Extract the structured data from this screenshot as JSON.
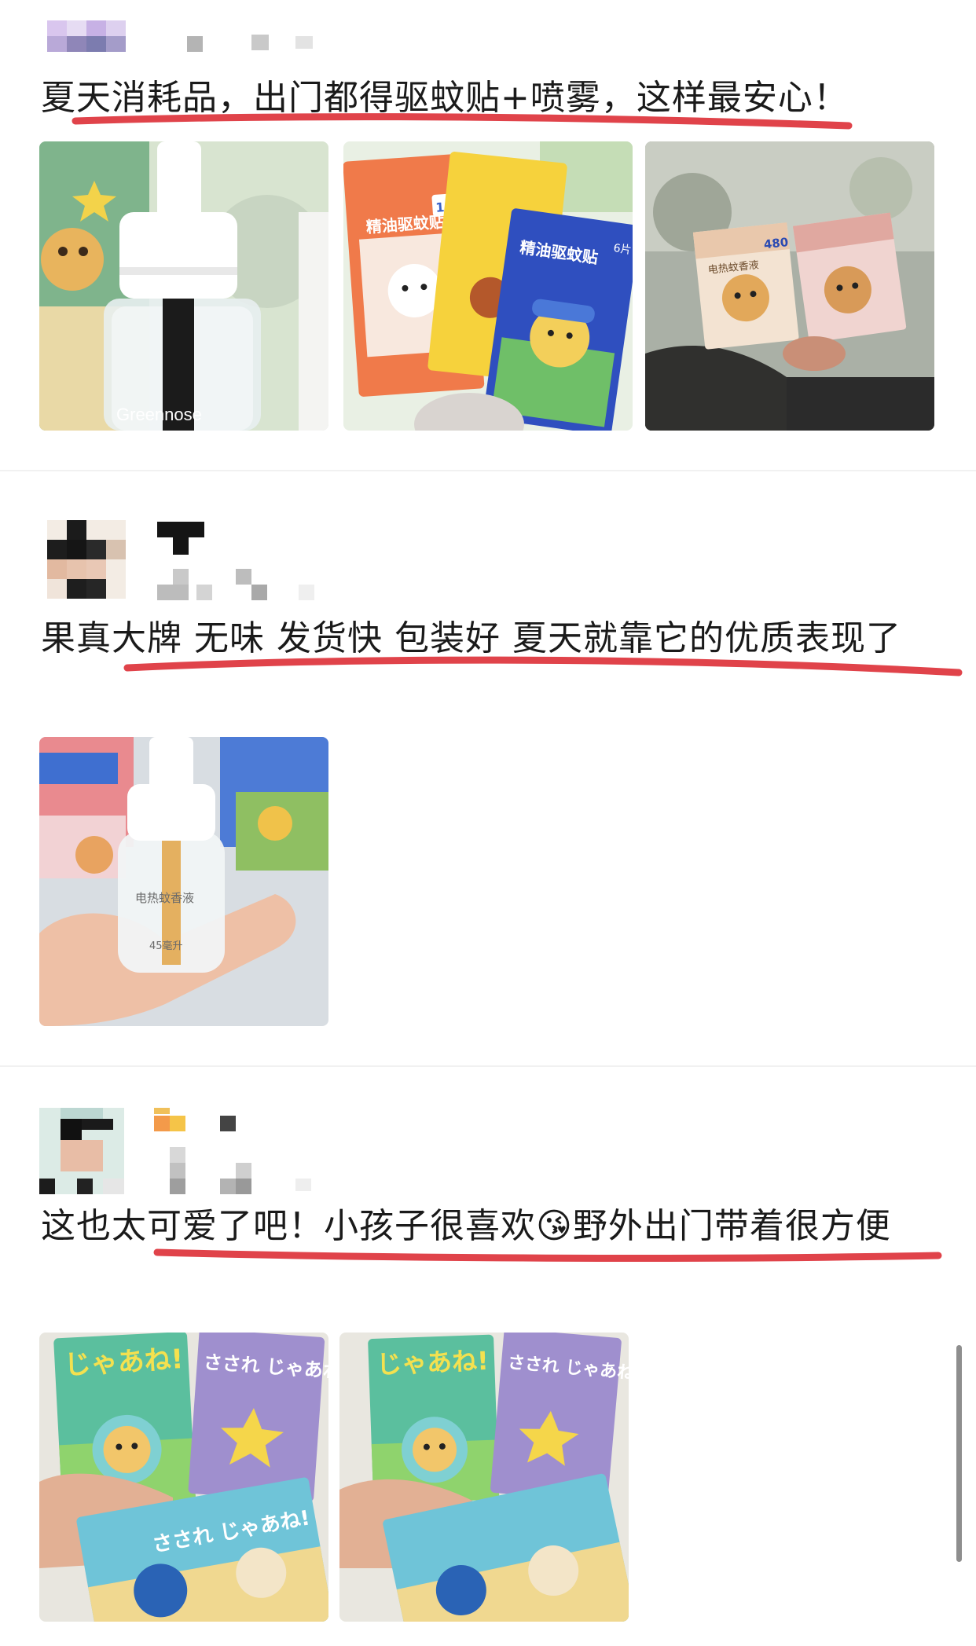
{
  "reviews": [
    {
      "text": "夏天消耗品，出门都得驱蚊贴+喷雾，这样最安心！",
      "photos": [
        "refill-bottle-photo",
        "patch-packs-photo",
        "liquid-boxes-photo"
      ]
    },
    {
      "text": "果真大牌 无味 发货快 包装好 夏天就靠它的优质表现了",
      "photos": [
        "bottle-in-hand-photo"
      ]
    },
    {
      "text": "这也太可爱了吧！小孩子很喜欢😘野外出门带着很方便",
      "photos": [
        "bracelet-packs-photo-1",
        "bracelet-packs-photo-2"
      ]
    }
  ],
  "photo_text": {
    "brand": "Greennose",
    "patch_name": "精油驱蚊贴",
    "patch_count_12": "12片",
    "patch_count_6": "6片",
    "liquid_name": "电热蚊香液",
    "liquid_volume": "45毫升",
    "liquid_box_480": "480",
    "bracelet_text_1": "じゃあね!",
    "bracelet_text_2": "さされ じゃあね!"
  },
  "colors": {
    "underline": "#e0434a",
    "text": "#1a1a1a",
    "divider": "#f1f1f1",
    "scrollbar": "#8e8e8e"
  }
}
